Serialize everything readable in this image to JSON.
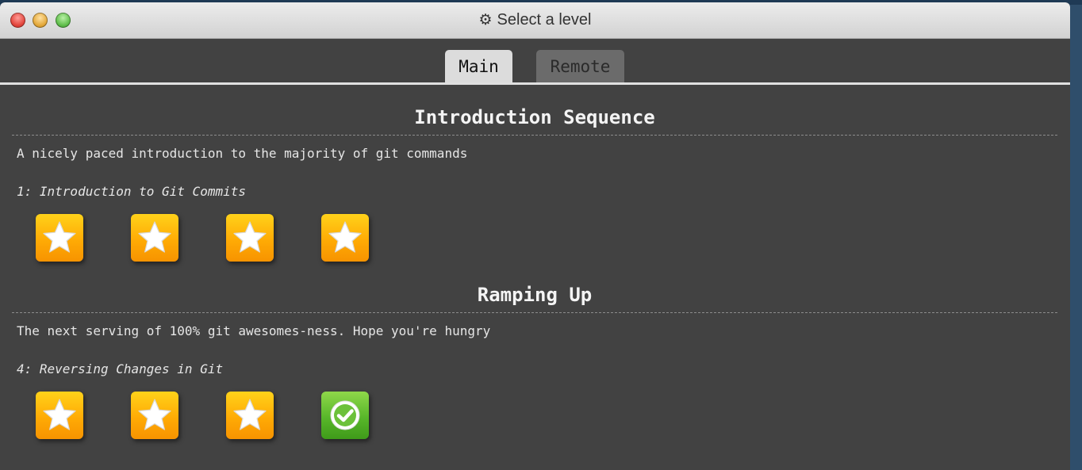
{
  "window": {
    "title": "Select a level",
    "gear_icon": "⚙"
  },
  "tabs": [
    {
      "label": "Main",
      "active": true
    },
    {
      "label": "Remote",
      "active": false
    }
  ],
  "sections": [
    {
      "title": "Introduction Sequence",
      "description": "A nicely paced introduction to the majority of git commands",
      "level_name": "1: Introduction to Git Commits",
      "levels": [
        "star",
        "star",
        "star",
        "star"
      ]
    },
    {
      "title": "Ramping Up",
      "description": "The next serving of 100% git awesomes-ness. Hope you're hungry",
      "level_name": "4: Reversing Changes in Git",
      "levels": [
        "star",
        "star",
        "star",
        "done"
      ]
    }
  ],
  "colors": {
    "star_tile": "#ffb30a",
    "done_tile": "#58b72a",
    "background": "#424242"
  }
}
